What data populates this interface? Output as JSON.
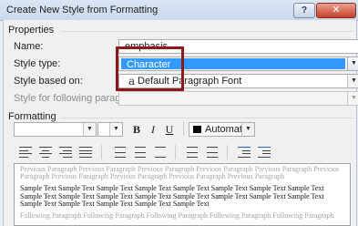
{
  "window": {
    "title": "Create New Style from Formatting",
    "help_label": "?",
    "close_label": "✕"
  },
  "properties": {
    "group_label": "Properties",
    "name_label": "Name:",
    "name_value": "emphasis",
    "style_type_label": "Style type:",
    "style_type_value": "Character",
    "based_on_label": "Style based on:",
    "based_on_glyph": "a",
    "based_on_value": "Default Paragraph Font",
    "following_label": "Style for following paragraph:",
    "following_value": ""
  },
  "formatting": {
    "group_label": "Formatting",
    "font_value": "",
    "size_value": "",
    "bold_label": "B",
    "italic_label": "I",
    "underline_label": "U",
    "color_value": "Automatic",
    "color_swatch": "#000000"
  },
  "icons": {
    "align_left": "align-left-icon",
    "align_center": "align-center-icon",
    "align_right": "align-right-icon",
    "justify": "justify-icon",
    "dropdown": "chevron-down-icon"
  },
  "preview": {
    "previous": "Previous Paragraph Previous Paragraph Previous Paragraph Previous Paragraph Previous Paragraph Previous Paragraph Previous Paragraph Previous Paragraph Previous Paragraph Previous Paragraph",
    "sample": "Sample Text Sample Text Sample Text Sample Text Sample Text Sample Text Sample Text Sample Text Sample Text Sample Text Sample Text Sample Text Sample Text Sample Text Sample Text Sample Text Sample Text Sample Text Sample Text Sample Text Sample Text",
    "following": "Following Paragraph Following Paragraph Following Paragraph Following Paragraph Following Paragraph"
  },
  "colors": {
    "selection": "#3399ff",
    "highlight_box": "#8b1a1a",
    "close_button": "#c4422b"
  }
}
